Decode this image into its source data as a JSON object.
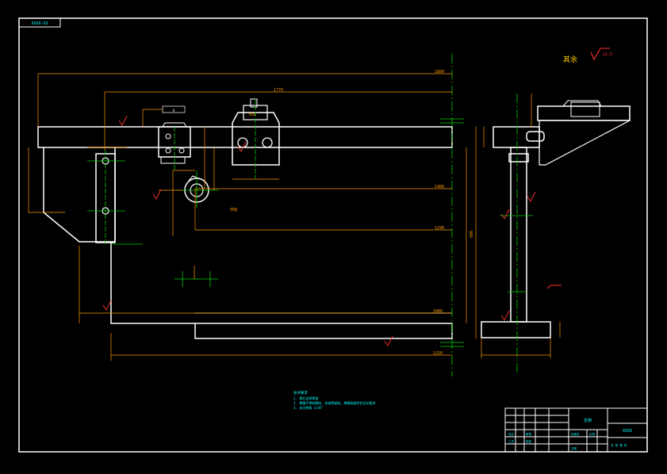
{
  "sheet": {
    "drawing_number": "ХХХХ-ХХ",
    "roughness_note": "其余",
    "roughness_value": "12.5"
  },
  "dimensions": {
    "top_overall": "1800",
    "top_inner": "1770",
    "mid_1": "1400",
    "mid_2": "1290",
    "bottom_1": "1080",
    "bottom_2": "1210",
    "side_height": "980"
  },
  "labels": {
    "weld_note": "焊缝",
    "bolt_note": "M16",
    "datum": "A"
  },
  "tech_requirements": {
    "title": "技术要求",
    "items": [
      "1. 焊后去除焊渣",
      "2. 焊缝不得有裂纹、夹渣等缺陷，焊脚高度符合设计要求",
      "3. 未注倒角 1×45°"
    ]
  },
  "title_block": {
    "part_name": "支架",
    "drawing_code": "XXXX",
    "fields": [
      "设计",
      "审核",
      "工艺",
      "批准",
      "标准化",
      "日期"
    ],
    "scale_label": "比例",
    "sheet_label": "共 张 第 张"
  },
  "colors": {
    "outline": "#ffffff",
    "dimension": "#ff9900",
    "center": "#00cc00",
    "annotation": "#ff3333",
    "text": "#00ffff"
  }
}
